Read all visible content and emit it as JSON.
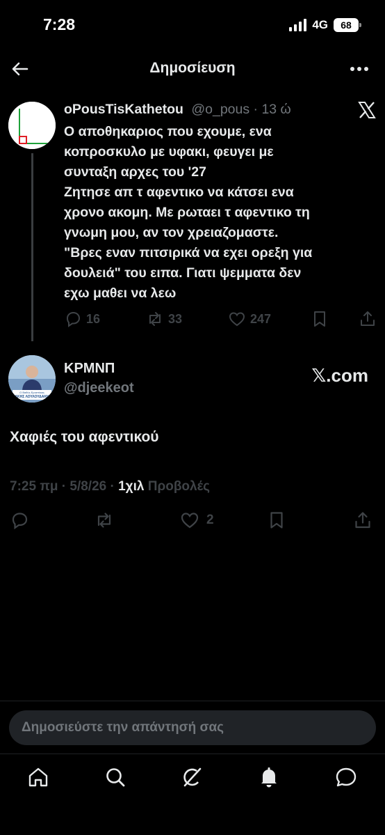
{
  "status_bar": {
    "time": "7:28",
    "network": "4G",
    "battery": "68"
  },
  "header": {
    "title": "Δημοσίευση"
  },
  "quoted_post": {
    "display_name": "oPousTisKathetou",
    "handle": "@o_pous",
    "separator": " · ",
    "time_ago": "13 ώ",
    "lines": [
      "Ο αποθηκαριος που εχουμε, ενα",
      "κοπροσκυλο με υφακι, φευγει με",
      "συνταξη αρχες του '27",
      "Ζητησε απ τ αφεντικο να κάτσει ενα",
      "χρονο ακομη. Με ρωταει τ αφεντικο τη",
      "γνωμη μου, αν τον χρειαζομαστε.",
      "\"Βρες εναν πιτσιρικά να εχει ορεξη για",
      "δουλειά\" του ειπα. Γιατι ψεμματα δεν",
      "εχω μαθει να λεω"
    ],
    "replies": "16",
    "reposts": "33",
    "likes": "247",
    "icons": [
      "reply-icon",
      "repost-icon",
      "like-icon",
      "bookmark-icon",
      "share-icon",
      "x-logo-icon"
    ]
  },
  "main_post": {
    "display_name": "ΚΡΜΝΠ",
    "handle": "@djeekeot",
    "watermark": "𝕏.com",
    "text": "Χαφιές του αφεντικού",
    "time": "7:25 πμ",
    "date": "5/8/26",
    "dot": " · ",
    "views_count": "1χιλ",
    "views_label": "Προβολές",
    "likes": "2",
    "avatar_caption_1": "Ο Βαθύς Ερυστέκας",
    "avatar_caption_2": "ΑΚΗΣ ΛΟΥΛΟΥΔΑΚΗ"
  },
  "reply_box": {
    "placeholder": "Δημοσιεύστε την απάντησή σας"
  },
  "tabs": [
    {
      "name": "home-icon"
    },
    {
      "name": "search-icon"
    },
    {
      "name": "grok-icon"
    },
    {
      "name": "notifications-icon"
    },
    {
      "name": "messages-icon"
    }
  ],
  "colors": {
    "background": "#000000",
    "text": "#e7e9ea",
    "muted": "#71767b",
    "dim_icon": "#3f4347"
  }
}
